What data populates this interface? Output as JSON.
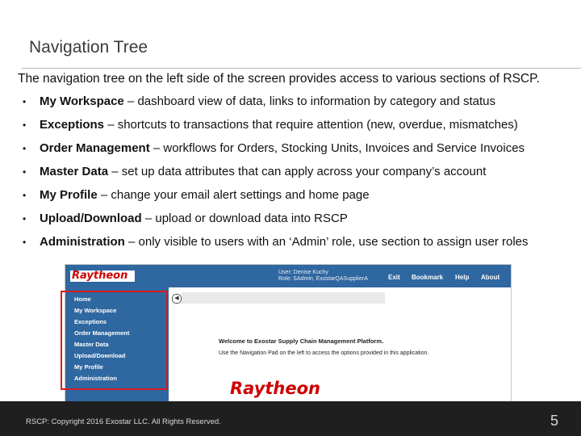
{
  "title": "Navigation Tree",
  "intro": "The navigation tree on the left side of the screen provides access to various sections of RSCP.",
  "bullets": [
    {
      "term": "My Workspace",
      "desc": " – dashboard view of data, links to information by category and status"
    },
    {
      "term": "Exceptions",
      "desc": " – shortcuts to transactions that require attention (new, overdue, mismatches)"
    },
    {
      "term": "Order Management",
      "desc": " – workflows for Orders, Stocking Units, Invoices and Service Invoices"
    },
    {
      "term": "Master Data",
      "desc": " – set up data attributes that can apply across your company’s account"
    },
    {
      "term": "My Profile",
      "desc": " – change your email alert settings and home page"
    },
    {
      "term": "Upload/Download",
      "desc": " – upload or download data into RSCP"
    },
    {
      "term": "Administration",
      "desc": " – only visible to users with an ‘Admin’ role, use section to assign user roles"
    }
  ],
  "screenshot": {
    "logo": "Raytheon",
    "user_line1": "User: Denise Kuchy",
    "user_line2": "Role: SAdmin, ExostarQASupplierA",
    "top_nav": [
      "Exit",
      "Bookmark",
      "Help",
      "About"
    ],
    "nav_items": [
      "Home",
      "My Workspace",
      "Exceptions",
      "Order Management",
      "Master Data",
      "Upload/Download",
      "My Profile",
      "Administration"
    ],
    "welcome": "Welcome to Exostar Supply Chain Management Platform.",
    "welcome_sub": "Use the Navigation Pad on the left to access the options provided in this application.",
    "big_logo": "Raytheon",
    "highlight_color": "#d81c1c",
    "collapse_icon": "arrow-left-icon"
  },
  "footer": {
    "copyright": "RSCP: Copyright 2016 Exostar LLC. All Rights Reserved.",
    "page_number": "5"
  }
}
